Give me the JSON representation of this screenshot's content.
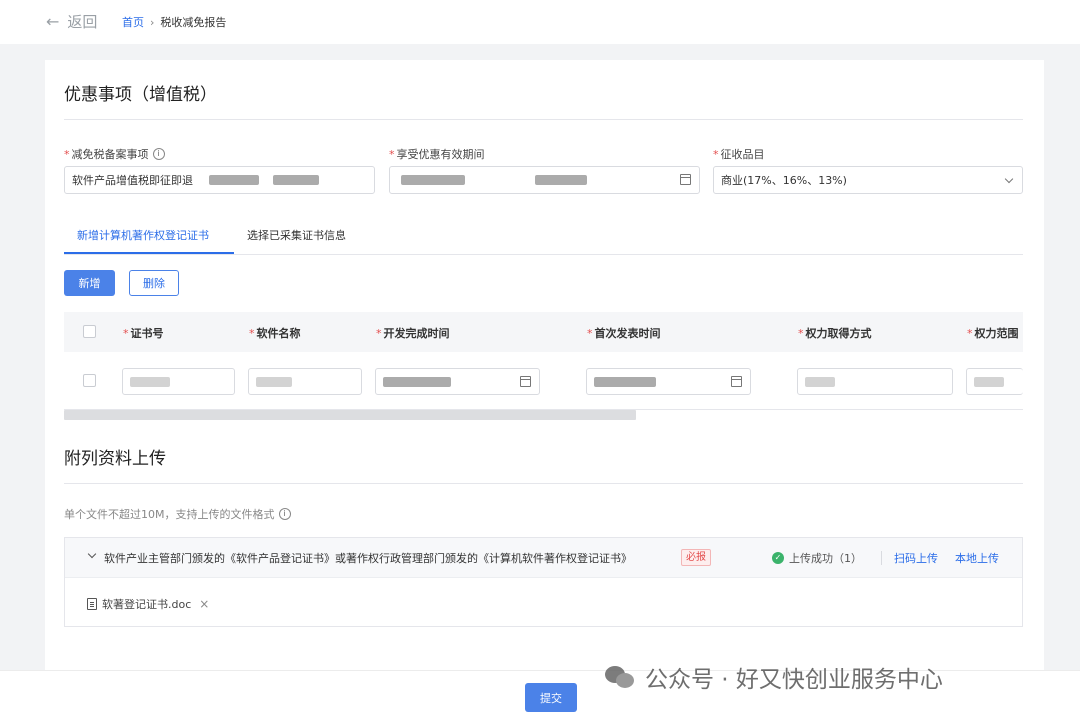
{
  "topbar": {
    "back_label": "返回",
    "breadcrumb_home": "首页",
    "breadcrumb_current": "税收减免报告"
  },
  "section1": {
    "title": "优惠事项（增值税）",
    "field1": {
      "label": "减免税备案事项",
      "value": "软件产品增值税即征即退"
    },
    "field2": {
      "label": "享受优惠有效期间"
    },
    "field3": {
      "label": "征收品目",
      "value": "商业(17%、16%、13%)"
    }
  },
  "tabs": [
    {
      "label": "新增计算机著作权登记证书",
      "active": true
    },
    {
      "label": "选择已采集证书信息",
      "active": false
    }
  ],
  "actions": {
    "add_label": "新增",
    "delete_label": "删除"
  },
  "table": {
    "columns": [
      "证书号",
      "软件名称",
      "开发完成时间",
      "首次发表时间",
      "权力取得方式",
      "权力范围"
    ]
  },
  "section2": {
    "title": "附列资料上传",
    "hint": "单个文件不超过10M，支持上传的文件格式",
    "item": {
      "title": "软件产业主管部门颁发的《软件产品登记证书》或著作权行政管理部门颁发的《计算机软件著作权登记证书》",
      "required_badge": "必报",
      "status": "上传成功（1）",
      "scan_upload": "扫码上传",
      "local_upload": "本地上传",
      "file_name": "软著登记证书.doc"
    }
  },
  "footer": {
    "submit_label": "提交"
  },
  "watermark": {
    "text": "公众号 · 好又快创业服务中心"
  },
  "colors": {
    "primary": "#2b6de8",
    "button": "#4b82e8",
    "required": "#e34d4d",
    "success": "#3bb36b"
  }
}
